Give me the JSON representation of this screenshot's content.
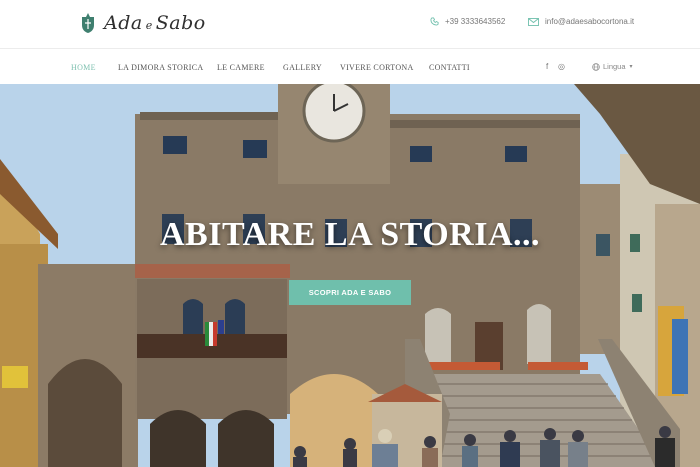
{
  "brand": {
    "name_part1": "Ada",
    "name_connector": "e",
    "name_part2": "Sabo",
    "accent": "#6fbfac"
  },
  "contact": {
    "phone": "+39 3333643562",
    "email": "info@adaesabocortona.it",
    "phone_icon": "phone-icon",
    "email_icon": "mail-icon"
  },
  "nav": {
    "items": [
      {
        "label": "HOME",
        "active": true
      },
      {
        "label": "LA DIMORA STORICA",
        "active": false
      },
      {
        "label": "LE CAMERE",
        "active": false
      },
      {
        "label": "GALLERY",
        "active": false
      },
      {
        "label": "VIVERE CORTONA",
        "active": false
      },
      {
        "label": "CONTATTI",
        "active": false
      }
    ],
    "social": {
      "facebook": "f",
      "instagram": "◎"
    },
    "language_label": "Lingua",
    "language_icon": "globe-icon"
  },
  "hero": {
    "title": "ABITARE LA STORIA...",
    "cta_label": "SCOPRI ADA E SABO",
    "image_description": "Historic town hall palace with clock tower and stone stairs in Cortona"
  }
}
